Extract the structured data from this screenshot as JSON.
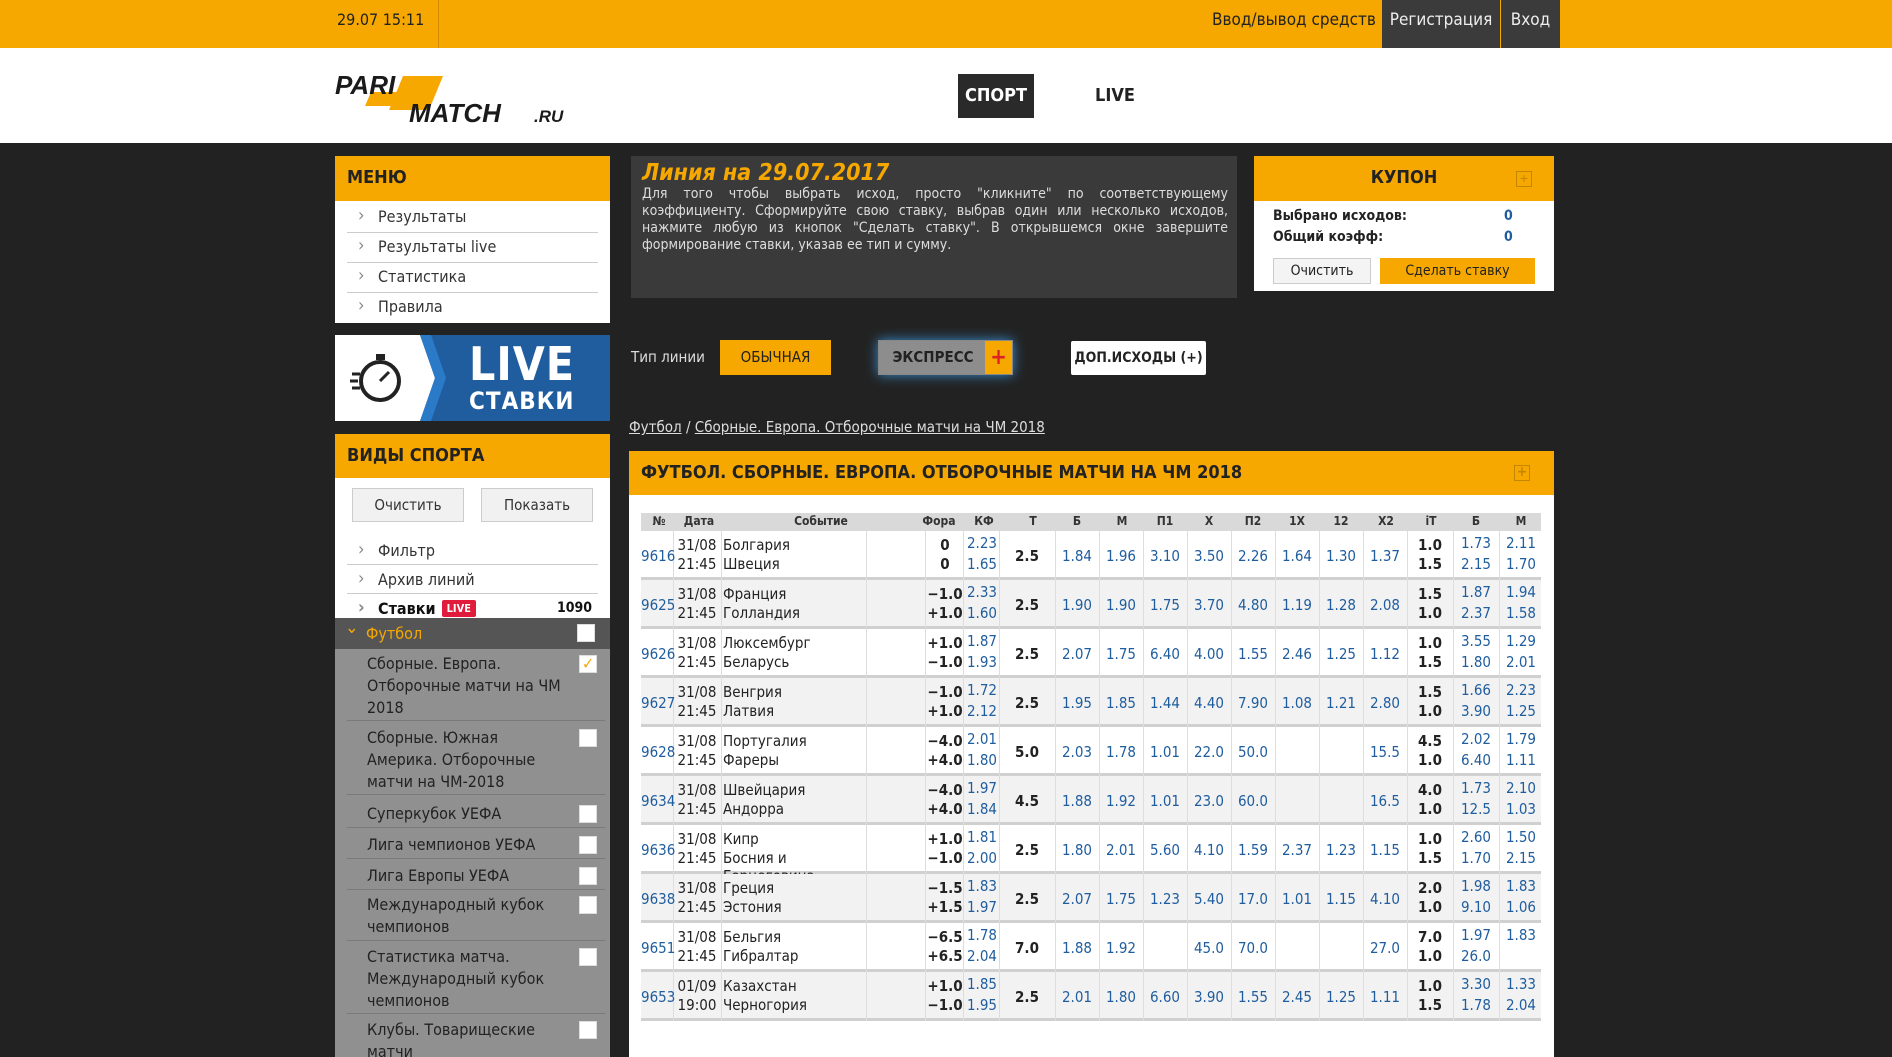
{
  "topbar": {
    "datetime": "29.07 15:11",
    "deposit": "Ввод/вывод средств",
    "register": "Регистрация",
    "login": "Вход"
  },
  "brand": {
    "top": "PARI",
    "bottom": "MATCH",
    "suffix": ".RU"
  },
  "nav": {
    "sport": "СПОРТ",
    "live": "LIVE"
  },
  "menu": {
    "title": "МЕНЮ",
    "items": [
      "Результаты",
      "Результаты live",
      "Статистика",
      "Правила"
    ]
  },
  "live_banner": {
    "big": "LIVE",
    "small": "СТАВКИ"
  },
  "sports": {
    "title": "ВИДЫ СПОРТА",
    "clear": "Очистить",
    "show": "Показать",
    "items": [
      "Фильтр",
      "Архив линий"
    ],
    "bets": {
      "label": "Ставки",
      "badge": "LIVE",
      "count": "1090"
    },
    "football": "Футбол",
    "subs": [
      "Сборные. Европа. Отборочные матчи на ЧМ 2018",
      "Сборные. Южная Америка. Отборочные матчи на ЧМ-2018",
      "Суперкубок УЕФА",
      "Лига чемпионов УЕФА",
      "Лига Европы УЕФА",
      "Международный кубок чемпионов",
      "Статистика матча. Международный кубок чемпионов",
      "Клубы. Товарищеские матчи"
    ]
  },
  "info": {
    "title": "Линия на 29.07.2017",
    "text": "Для того чтобы выбрать исход, просто \"кликните\" по соответствующему коэффициенту. Сформируйте свою ставку, выбрав один или несколько исходов, нажмите любую из кнопок \"Сделать ставку\". В открывшемся окне завершите формирование ставки, указав ее тип и сумму."
  },
  "coupon": {
    "title": "КУПОН",
    "selected_label": "Выбрано исходов:",
    "selected_value": "0",
    "odds_label": "Общий коэфф:",
    "odds_value": "0",
    "clear": "Очистить",
    "make_bet": "Сделать ставку"
  },
  "line_type": {
    "label": "Тип линии",
    "normal": "ОБЫЧНАЯ",
    "express": "ЭКСПРЕСС",
    "extra": "ДОП.ИСХОДЫ (+)"
  },
  "breadcrumb": {
    "first": "Футбол",
    "sep": " / ",
    "second": "Сборные. Европа. Отборочные матчи на ЧМ 2018"
  },
  "table": {
    "title": "ФУТБОЛ. СБОРНЫЕ. ЕВРОПА. ОТБОРОЧНЫЕ МАТЧИ НА ЧМ 2018",
    "headers": [
      "№",
      "Дата",
      "Событие",
      "Фора",
      "КФ",
      "Т",
      "Б",
      "М",
      "П1",
      "Х",
      "П2",
      "1Х",
      "12",
      "Х2",
      "iT",
      "Б",
      "М"
    ],
    "rows": [
      {
        "num": "9616",
        "date": "31/08",
        "time": "21:45",
        "t1": "Болгария",
        "t2": "Швеция",
        "f1": "0",
        "f2": "0",
        "k1": "2.23",
        "k2": "1.65",
        "t": "2.5",
        "b": "1.84",
        "m": "1.96",
        "p1": "3.10",
        "x": "3.50",
        "p2": "2.26",
        "x1": "1.64",
        "x12": "1.30",
        "x2": "1.37",
        "it1": "1.0",
        "it2": "1.5",
        "ib1": "1.73",
        "ib2": "2.15",
        "im1": "2.11",
        "im2": "1.70"
      },
      {
        "num": "9625",
        "date": "31/08",
        "time": "21:45",
        "t1": "Франция",
        "t2": "Голландия",
        "f1": "−1.0",
        "f2": "+1.0",
        "k1": "2.33",
        "k2": "1.60",
        "t": "2.5",
        "b": "1.90",
        "m": "1.90",
        "p1": "1.75",
        "x": "3.70",
        "p2": "4.80",
        "x1": "1.19",
        "x12": "1.28",
        "x2": "2.08",
        "it1": "1.5",
        "it2": "1.0",
        "ib1": "1.87",
        "ib2": "2.37",
        "im1": "1.94",
        "im2": "1.58"
      },
      {
        "num": "9626",
        "date": "31/08",
        "time": "21:45",
        "t1": "Люксембург",
        "t2": "Беларусь",
        "f1": "+1.0",
        "f2": "−1.0",
        "k1": "1.87",
        "k2": "1.93",
        "t": "2.5",
        "b": "2.07",
        "m": "1.75",
        "p1": "6.40",
        "x": "4.00",
        "p2": "1.55",
        "x1": "2.46",
        "x12": "1.25",
        "x2": "1.12",
        "it1": "1.0",
        "it2": "1.5",
        "ib1": "3.55",
        "ib2": "1.80",
        "im1": "1.29",
        "im2": "2.01"
      },
      {
        "num": "9627",
        "date": "31/08",
        "time": "21:45",
        "t1": "Венгрия",
        "t2": "Латвия",
        "f1": "−1.0",
        "f2": "+1.0",
        "k1": "1.72",
        "k2": "2.12",
        "t": "2.5",
        "b": "1.95",
        "m": "1.85",
        "p1": "1.44",
        "x": "4.40",
        "p2": "7.90",
        "x1": "1.08",
        "x12": "1.21",
        "x2": "2.80",
        "it1": "1.5",
        "it2": "1.0",
        "ib1": "1.66",
        "ib2": "3.90",
        "im1": "2.23",
        "im2": "1.25"
      },
      {
        "num": "9628",
        "date": "31/08",
        "time": "21:45",
        "t1": "Португалия",
        "t2": "Фареры",
        "f1": "−4.0",
        "f2": "+4.0",
        "k1": "2.01",
        "k2": "1.80",
        "t": "5.0",
        "b": "2.03",
        "m": "1.78",
        "p1": "1.01",
        "x": "22.0",
        "p2": "50.0",
        "x1": "",
        "x12": "",
        "x2": "15.5",
        "it1": "4.5",
        "it2": "1.0",
        "ib1": "2.02",
        "ib2": "6.40",
        "im1": "1.79",
        "im2": "1.11"
      },
      {
        "num": "9634",
        "date": "31/08",
        "time": "21:45",
        "t1": "Швейцария",
        "t2": "Андорра",
        "f1": "−4.0",
        "f2": "+4.0",
        "k1": "1.97",
        "k2": "1.84",
        "t": "4.5",
        "b": "1.88",
        "m": "1.92",
        "p1": "1.01",
        "x": "23.0",
        "p2": "60.0",
        "x1": "",
        "x12": "",
        "x2": "16.5",
        "it1": "4.0",
        "it2": "1.0",
        "ib1": "1.73",
        "ib2": "12.5",
        "im1": "2.10",
        "im2": "1.03"
      },
      {
        "num": "9636",
        "date": "31/08",
        "time": "21:45",
        "t1": "Кипр",
        "t2": "Босния и Герцеговина",
        "f1": "+1.0",
        "f2": "−1.0",
        "k1": "1.81",
        "k2": "2.00",
        "t": "2.5",
        "b": "1.80",
        "m": "2.01",
        "p1": "5.60",
        "x": "4.10",
        "p2": "1.59",
        "x1": "2.37",
        "x12": "1.23",
        "x2": "1.15",
        "it1": "1.0",
        "it2": "1.5",
        "ib1": "2.60",
        "ib2": "1.70",
        "im1": "1.50",
        "im2": "2.15"
      },
      {
        "num": "9638",
        "date": "31/08",
        "time": "21:45",
        "t1": "Греция",
        "t2": "Эстония",
        "f1": "−1.5",
        "f2": "+1.5",
        "k1": "1.83",
        "k2": "1.97",
        "t": "2.5",
        "b": "2.07",
        "m": "1.75",
        "p1": "1.23",
        "x": "5.40",
        "p2": "17.0",
        "x1": "1.01",
        "x12": "1.15",
        "x2": "4.10",
        "it1": "2.0",
        "it2": "1.0",
        "ib1": "1.98",
        "ib2": "9.10",
        "im1": "1.83",
        "im2": "1.06"
      },
      {
        "num": "9651",
        "date": "31/08",
        "time": "21:45",
        "t1": "Бельгия",
        "t2": "Гибралтар",
        "f1": "−6.5",
        "f2": "+6.5",
        "k1": "1.78",
        "k2": "2.04",
        "t": "7.0",
        "b": "1.88",
        "m": "1.92",
        "p1": "",
        "x": "45.0",
        "p2": "70.0",
        "x1": "",
        "x12": "",
        "x2": "27.0",
        "it1": "7.0",
        "it2": "1.0",
        "ib1": "1.97",
        "ib2": "26.0",
        "im1": "1.83",
        "im2": ""
      },
      {
        "num": "9653",
        "date": "01/09",
        "time": "19:00",
        "t1": "Казахстан",
        "t2": "Черногория",
        "f1": "+1.0",
        "f2": "−1.0",
        "k1": "1.85",
        "k2": "1.95",
        "t": "2.5",
        "b": "2.01",
        "m": "1.80",
        "p1": "6.60",
        "x": "3.90",
        "p2": "1.55",
        "x1": "2.45",
        "x12": "1.25",
        "x2": "1.11",
        "it1": "1.0",
        "it2": "1.5",
        "ib1": "3.30",
        "ib2": "1.78",
        "im1": "1.33",
        "im2": "2.04"
      }
    ]
  },
  "colors": {
    "accent": "#f6a800",
    "dark": "#222222",
    "link": "#1f5d9e",
    "live_red": "#e01b3c"
  }
}
